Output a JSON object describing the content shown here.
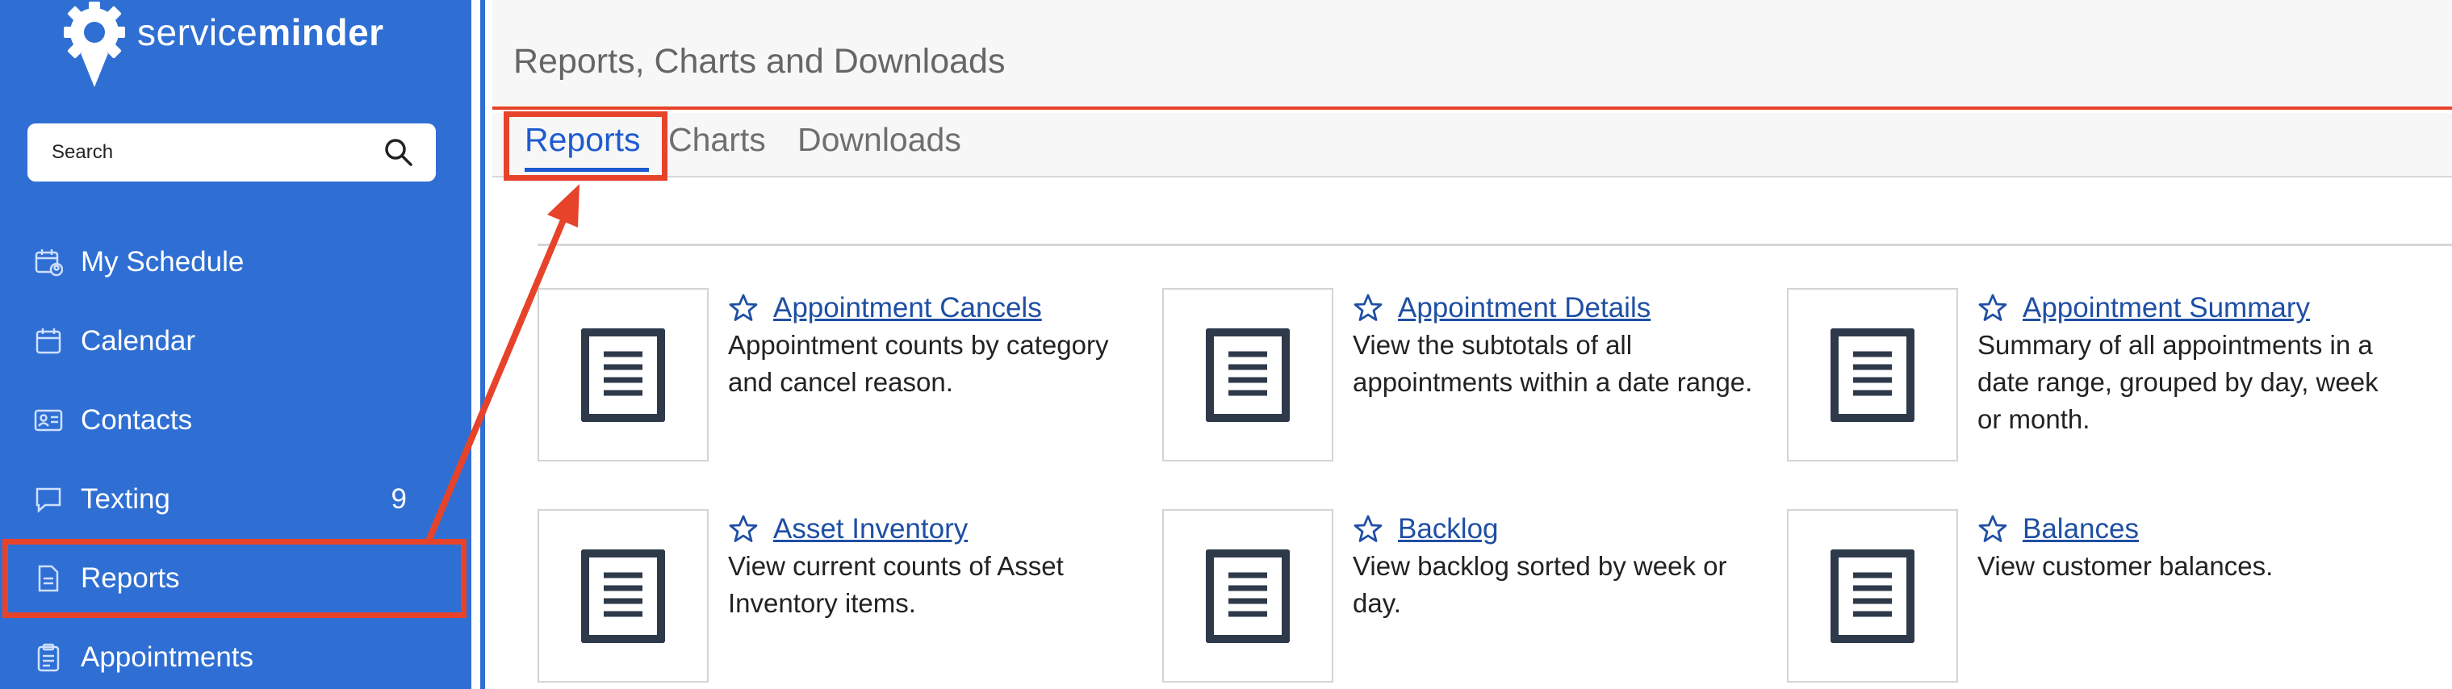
{
  "app": {
    "logo_text_light": "service",
    "logo_text_bold": "minder"
  },
  "search": {
    "placeholder": "Search"
  },
  "sidebar": {
    "items": [
      {
        "label": "My Schedule",
        "icon": "calendar-user-icon"
      },
      {
        "label": "Calendar",
        "icon": "calendar-icon"
      },
      {
        "label": "Contacts",
        "icon": "contact-card-icon"
      },
      {
        "label": "Texting",
        "icon": "chat-bubble-icon",
        "badge": "9"
      },
      {
        "label": "Reports",
        "icon": "document-icon"
      },
      {
        "label": "Appointments",
        "icon": "clipboard-icon"
      }
    ]
  },
  "header": {
    "title": "Reports, Charts and Downloads"
  },
  "tabs": [
    {
      "label": "Reports",
      "active": true
    },
    {
      "label": "Charts",
      "active": false
    },
    {
      "label": "Downloads",
      "active": false
    }
  ],
  "reports": [
    {
      "title": "Appointment Cancels",
      "desc": "Appointment counts by category and cancel reason."
    },
    {
      "title": "Appointment Details",
      "desc": "View the subtotals of all appointments within a date range."
    },
    {
      "title": "Appointment Summary",
      "desc": "Summary of all appointments in a date range, grouped by day, week or month."
    },
    {
      "title": "Asset Inventory",
      "desc": "View current counts of Asset Inventory items."
    },
    {
      "title": "Backlog",
      "desc": "View backlog sorted by week or day."
    },
    {
      "title": "Balances",
      "desc": "View customer balances."
    }
  ],
  "colors": {
    "sidebar": "#2f6fd4",
    "accent": "#1f5bd0",
    "highlight": "#e7432b"
  }
}
